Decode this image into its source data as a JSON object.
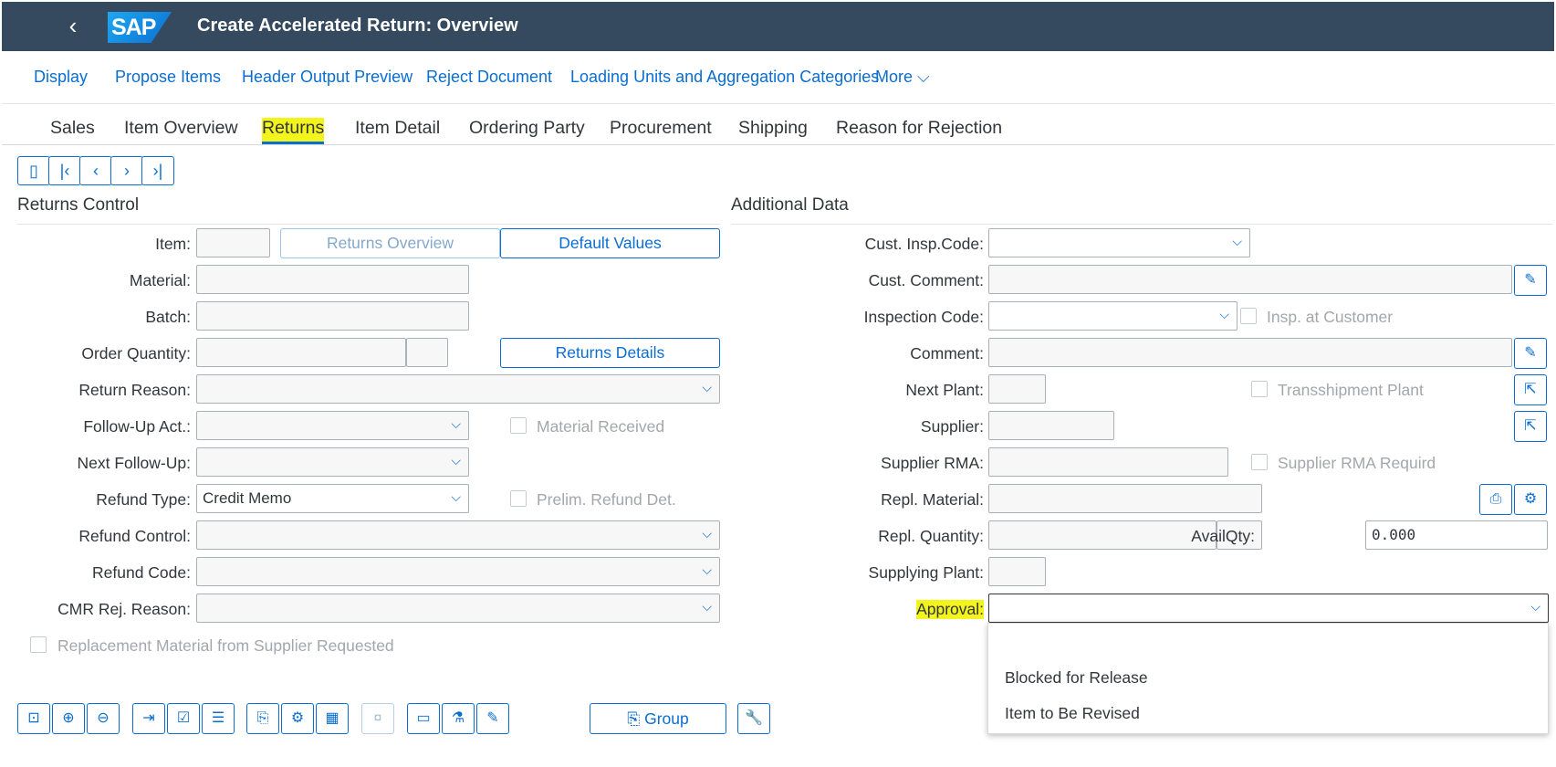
{
  "shell": {
    "back_icon": "‹",
    "logo": "SAP",
    "title": "Create Accelerated Return: Overview"
  },
  "toolbar": [
    "Display",
    "Propose Items",
    "Header Output Preview",
    "Reject Document",
    "Loading Units and Aggregation Categories",
    "More"
  ],
  "tabs": [
    "Sales",
    "Item Overview",
    "Returns",
    "Item Detail",
    "Ordering Party",
    "Procurement",
    "Shipping",
    "Reason for Rejection"
  ],
  "active_tab": "Returns",
  "returns_control": {
    "title": "Returns Control",
    "item_label": "Item:",
    "returns_overview_btn": "Returns Overview",
    "default_values_btn": "Default Values",
    "material_label": "Material:",
    "batch_label": "Batch:",
    "order_qty_label": "Order Quantity:",
    "returns_details_btn": "Returns Details",
    "return_reason_label": "Return Reason:",
    "follow_up_label": "Follow-Up Act.:",
    "material_received": "Material Received",
    "next_follow_up_label": "Next Follow-Up:",
    "refund_type_label": "Refund Type:",
    "refund_type_value": "Credit Memo",
    "prelim_refund": "Prelim. Refund Det.",
    "refund_control_label": "Refund Control:",
    "refund_code_label": "Refund Code:",
    "cmr_rej_label": "CMR Rej. Reason:",
    "replacement_req": "Replacement Material from Supplier Requested"
  },
  "additional_data": {
    "title": "Additional Data",
    "cust_insp_label": "Cust. Insp.Code:",
    "cust_comment_label": "Cust. Comment:",
    "inspection_code_label": "Inspection Code:",
    "insp_at_customer": "Insp. at Customer",
    "comment_label": "Comment:",
    "next_plant_label": "Next Plant:",
    "transshipment": "Transshipment Plant",
    "supplier_label": "Supplier:",
    "supplier_rma_label": "Supplier RMA:",
    "supplier_rma_req": "Supplier RMA Requird",
    "repl_material_label": "Repl. Material:",
    "repl_qty_label": "Repl. Quantity:",
    "avail_qty_label": "AvailQty:",
    "avail_qty_value": "0.000",
    "supplying_plant_label": "Supplying Plant:",
    "approval_label": "Approval:"
  },
  "approval_options": [
    "",
    "Blocked for Release",
    "Item to Be Revised"
  ],
  "footer": {
    "group_btn": "Group"
  },
  "colors": {
    "shell": "#354a5f",
    "accent": "#0a6ed1",
    "highlight": "#f3f31e"
  }
}
